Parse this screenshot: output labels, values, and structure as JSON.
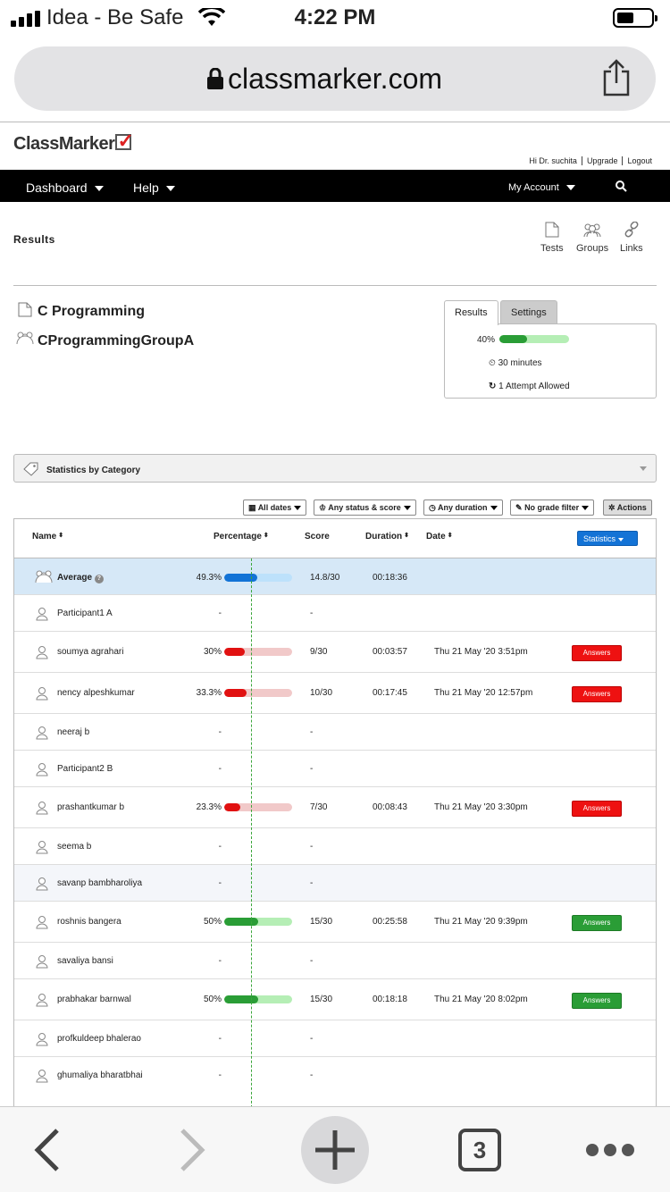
{
  "status_bar": {
    "carrier": "Idea - Be Safe",
    "time": "4:22 PM"
  },
  "browser": {
    "url": "classmarker.com",
    "tab_count": "3"
  },
  "header": {
    "logo_text": "ClassMarker",
    "links": [
      "Hi Dr. suchita",
      "Upgrade",
      "Logout"
    ]
  },
  "nav": {
    "dashboard": "Dashboard",
    "help": "Help",
    "account": "My Account"
  },
  "page": {
    "title": "Results",
    "tools": [
      "Tests",
      "Groups",
      "Links"
    ],
    "test_name": "C Programming",
    "group_name": "CProgrammingGroupA"
  },
  "summary": {
    "tabs": [
      "Results",
      "Settings"
    ],
    "pass_percent": "40%",
    "pass_fraction": 0.4,
    "duration": "30 minutes",
    "attempts": "1 Attempt Allowed"
  },
  "category_bar": "Statistics by Category",
  "filters": [
    "All dates",
    "Any status & score",
    "Any duration",
    "No grade filter",
    "Actions"
  ],
  "table": {
    "headers": {
      "name": "Name",
      "percentage": "Percentage",
      "score": "Score",
      "duration": "Duration",
      "date": "Date"
    },
    "statistics_button": "Statistics",
    "average": {
      "name": "Average",
      "percentage": "49.3%",
      "fraction": 0.493,
      "score": "14.8/30",
      "duration": "00:18:36"
    },
    "rows": [
      {
        "name": "Participant1 A",
        "percentage": "-",
        "score": "-",
        "duration": "",
        "date": "",
        "answers": ""
      },
      {
        "name": "soumya agrahari",
        "percentage": "30%",
        "fraction": 0.3,
        "status": "fail",
        "score": "9/30",
        "duration": "00:03:57",
        "date": "Thu 21 May '20 3:51pm",
        "answers": "Answers"
      },
      {
        "name": "nency alpeshkumar",
        "percentage": "33.3%",
        "fraction": 0.333,
        "status": "fail",
        "score": "10/30",
        "duration": "00:17:45",
        "date": "Thu 21 May '20 12:57pm",
        "answers": "Answers"
      },
      {
        "name": "neeraj b",
        "percentage": "-",
        "score": "-",
        "duration": "",
        "date": "",
        "answers": ""
      },
      {
        "name": "Participant2 B",
        "percentage": "-",
        "score": "-",
        "duration": "",
        "date": "",
        "answers": ""
      },
      {
        "name": "prashantkumar b",
        "percentage": "23.3%",
        "fraction": 0.233,
        "status": "fail",
        "score": "7/30",
        "duration": "00:08:43",
        "date": "Thu 21 May '20 3:30pm",
        "answers": "Answers"
      },
      {
        "name": "seema b",
        "percentage": "-",
        "score": "-",
        "duration": "",
        "date": "",
        "answers": ""
      },
      {
        "name": "savanp bambharoliya",
        "percentage": "-",
        "score": "-",
        "duration": "",
        "date": "",
        "answers": ""
      },
      {
        "name": "roshnis bangera",
        "percentage": "50%",
        "fraction": 0.5,
        "status": "pass",
        "score": "15/30",
        "duration": "00:25:58",
        "date": "Thu 21 May '20 9:39pm",
        "answers": "Answers"
      },
      {
        "name": "savaliya bansi",
        "percentage": "-",
        "score": "-",
        "duration": "",
        "date": "",
        "answers": ""
      },
      {
        "name": "prabhakar barnwal",
        "percentage": "50%",
        "fraction": 0.5,
        "status": "pass",
        "score": "15/30",
        "duration": "00:18:18",
        "date": "Thu 21 May '20 8:02pm",
        "answers": "Answers"
      },
      {
        "name": "profkuldeep bhalerao",
        "percentage": "-",
        "score": "-",
        "duration": "",
        "date": "",
        "answers": ""
      },
      {
        "name": "ghumaliya bharatbhai",
        "percentage": "-",
        "score": "-",
        "duration": "",
        "date": "",
        "answers": ""
      }
    ]
  },
  "colors": {
    "pass": "#2a9d36",
    "fail": "#e11111",
    "average": "#1373d6",
    "nav": "#000000"
  }
}
